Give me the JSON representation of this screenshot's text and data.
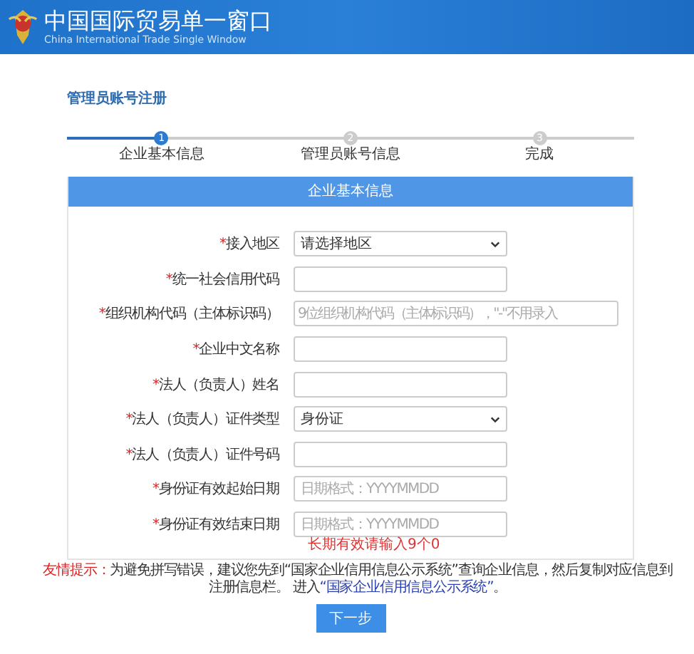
{
  "header": {
    "title": "中国国际贸易单一窗口",
    "subtitle": "China International Trade Single Window"
  },
  "page_title": "管理员账号注册",
  "steps": [
    {
      "number": "1",
      "label": "企业基本信息",
      "selected": true
    },
    {
      "number": "2",
      "label": "管理员账号信息",
      "selected": false
    },
    {
      "number": "3",
      "label": "完成",
      "selected": false
    }
  ],
  "section_title": "企业基本信息",
  "fields": [
    {
      "mark": "*",
      "label": "接入地区",
      "kind": "select",
      "value": "请选择地区"
    },
    {
      "mark": "*",
      "label": "统一社会信用代码",
      "kind": "input"
    },
    {
      "mark": "*",
      "label": "组织机构代码（主体标识码）",
      "kind": "input",
      "placeholder": "9位组织机构代码（主体标识码），\"-\"不用录入"
    },
    {
      "mark": "*",
      "label": "企业中文名称",
      "kind": "input"
    },
    {
      "mark": "*",
      "label": "法人（负责人）姓名",
      "kind": "input"
    },
    {
      "mark": "*",
      "label": "法人（负责人）证件类型",
      "kind": "select",
      "value": "身份证"
    },
    {
      "mark": "*",
      "label": "法人（负责人）证件号码",
      "kind": "input"
    },
    {
      "mark": "*",
      "label": "身份证有效起始日期",
      "kind": "input",
      "placeholder": "日期格式：YYYYMMDD"
    },
    {
      "mark": "*",
      "label": "身份证有效结束日期",
      "kind": "input",
      "placeholder": "日期格式：YYYYMMDD",
      "hint": "长期有效请输入9个0"
    }
  ],
  "notice": {
    "label": "友情提示：",
    "text": "为避免拼写错误，建议您先到“国家企业信用信息公示系统”查询企业信息，然后复制对应信息到注册信息栏。 进入",
    "link": "“国家企业信用信息公示系统”",
    "end": "。"
  },
  "next_button": "下一步"
}
